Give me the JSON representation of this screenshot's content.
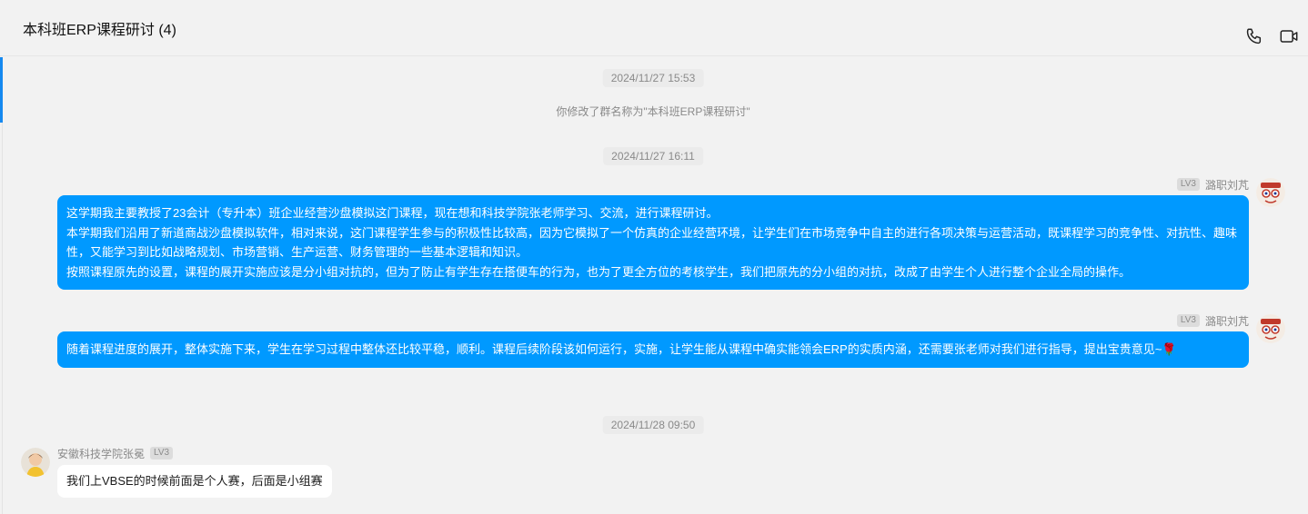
{
  "chat": {
    "title": "本科班ERP课程研讨 (4)",
    "icons": [
      "phone-icon",
      "video-call-icon"
    ]
  },
  "timeline": [
    {
      "type": "timestamp",
      "text": "2024/11/27 15:53"
    },
    {
      "type": "system",
      "text": "你修改了群名称为\"本科班ERP课程研讨\""
    },
    {
      "type": "timestamp",
      "text": "2024/11/27 16:11"
    },
    {
      "type": "timestamp",
      "text": "2024/11/28 09:50"
    }
  ],
  "messages": [
    {
      "direction": "outgoing",
      "level": "LV3",
      "sender": "潞职刘芃",
      "lines": [
        "这学期我主要教授了23会计（专升本）班企业经营沙盘模拟这门课程，现在想和科技学院张老师学习、交流，进行课程研讨。",
        "本学期我们沿用了新道商战沙盘模拟软件，相对来说，这门课程学生参与的积极性比较高，因为它模拟了一个仿真的企业经营环境，让学生们在市场竞争中自主的进行各项决策与运营活动，既课程学习的竞争性、对抗性、趣味性，又能学习到比如战略规划、市场营销、生产运营、财务管理的一些基本逻辑和知识。",
        "按照课程原先的设置，课程的展开实施应该是分小组对抗的，但为了防止有学生存在搭便车的行为，也为了更全方位的考核学生，我们把原先的分小组的对抗，改成了由学生个人进行整个企业全局的操作。"
      ]
    },
    {
      "direction": "outgoing",
      "level": "LV3",
      "sender": "潞职刘芃",
      "text": "随着课程进度的展开，整体实施下来，学生在学习过程中整体还比较平稳，顺利。课程后续阶段该如何运行，实施，让学生能从课程中确实能领会ERP的实质内涵，还需要张老师对我们进行指导，提出宝贵意见~",
      "emoji": "🌹"
    },
    {
      "direction": "incoming",
      "sender": "安徽科技学院张冕",
      "level": "LV3",
      "text": "我们上VBSE的时候前面是个人赛，后面是小组赛"
    }
  ],
  "colors": {
    "outgoing_bubble": "#0099ff",
    "incoming_bubble": "#ffffff",
    "background": "#f2f2f2",
    "accent": "#1689f0"
  }
}
